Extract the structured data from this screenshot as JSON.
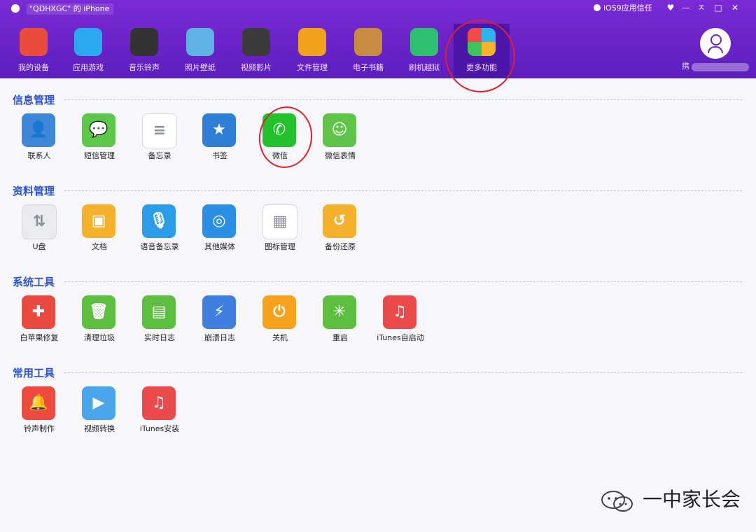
{
  "window": {
    "device_name": "\"QDHXGC\" 的 iPhone",
    "trust_label": "iOS9应用信任",
    "controls": [
      "♥",
      "—",
      "ㅈ",
      "□",
      "✕"
    ]
  },
  "nav": {
    "items": [
      {
        "label": "我的设备",
        "icon": "my-device-icon",
        "color": "#e94b3c"
      },
      {
        "label": "应用游戏",
        "icon": "app-store-icon",
        "color": "#2aa8f2"
      },
      {
        "label": "音乐铃声",
        "icon": "music-ringtone-icon",
        "color": "#333333"
      },
      {
        "label": "照片壁纸",
        "icon": "photo-wallpaper-icon",
        "color": "#5fb1e6"
      },
      {
        "label": "视频影片",
        "icon": "video-clapper-icon",
        "color": "#3b3b3b"
      },
      {
        "label": "文件管理",
        "icon": "file-folder-icon",
        "color": "#f0a21c"
      },
      {
        "label": "电子书籍",
        "icon": "ebook-icon",
        "color": "#c98a42"
      },
      {
        "label": "刷机越狱",
        "icon": "flash-jailbreak-icon",
        "color": "#2fbf71"
      },
      {
        "label": "更多功能",
        "icon": "more-features-icon",
        "color": "#ffffff",
        "active": true
      }
    ],
    "user_label": "携"
  },
  "sections": [
    {
      "title": "信息管理",
      "items": [
        {
          "label": "联系人",
          "icon": "contacts-icon",
          "color": "#3d86d8",
          "glyph": "👤"
        },
        {
          "label": "短信管理",
          "icon": "sms-icon",
          "color": "#5cc84a",
          "glyph": "💬"
        },
        {
          "label": "备忘录",
          "icon": "notes-icon",
          "color": "#ffffff",
          "glyph": "≡"
        },
        {
          "label": "书签",
          "icon": "bookmark-icon",
          "color": "#2f7fd6",
          "glyph": "★"
        },
        {
          "label": "微信",
          "icon": "wechat-icon",
          "color": "#23c12c",
          "glyph": "✆"
        },
        {
          "label": "微信表情",
          "icon": "wechat-emoji-icon",
          "color": "#5ec54a",
          "glyph": "☺"
        }
      ]
    },
    {
      "title": "资料管理",
      "items": [
        {
          "label": "U盘",
          "icon": "usb-drive-icon",
          "color": "#e9ebef",
          "glyph": "⇅"
        },
        {
          "label": "文档",
          "icon": "document-icon",
          "color": "#f6b12c",
          "glyph": "▣"
        },
        {
          "label": "语音备忘录",
          "icon": "voice-memo-icon",
          "color": "#2b9de8",
          "glyph": "🎙"
        },
        {
          "label": "其他媒体",
          "icon": "other-media-icon",
          "color": "#2c8fe6",
          "glyph": "◎"
        },
        {
          "label": "图标管理",
          "icon": "icon-manager-icon",
          "color": "#ffffff",
          "glyph": "▦"
        },
        {
          "label": "备份还原",
          "icon": "backup-restore-icon",
          "color": "#f6b12c",
          "glyph": "↺"
        }
      ]
    },
    {
      "title": "系统工具",
      "items": [
        {
          "label": "白苹果修复",
          "icon": "apple-repair-icon",
          "color": "#ea4a3f",
          "glyph": "✚"
        },
        {
          "label": "清理垃圾",
          "icon": "trash-clean-icon",
          "color": "#5cbf3f",
          "glyph": "🗑"
        },
        {
          "label": "实时日志",
          "icon": "realtime-log-icon",
          "color": "#5cbf3f",
          "glyph": "▤"
        },
        {
          "label": "崩溃日志",
          "icon": "crash-log-icon",
          "color": "#3f7fe0",
          "glyph": "⚡"
        },
        {
          "label": "关机",
          "icon": "power-off-icon",
          "color": "#f6a21c",
          "glyph": "⏻"
        },
        {
          "label": "重启",
          "icon": "restart-icon",
          "color": "#5cbf3f",
          "glyph": "✳"
        },
        {
          "label": "iTunes自启动",
          "icon": "itunes-autostart-icon",
          "color": "#ea4a4a",
          "glyph": "♫"
        }
      ]
    },
    {
      "title": "常用工具",
      "items": [
        {
          "label": "铃声制作",
          "icon": "ringtone-maker-icon",
          "color": "#ef4a3f",
          "glyph": "🔔"
        },
        {
          "label": "视频转换",
          "icon": "video-convert-icon",
          "color": "#4aa6ea",
          "glyph": "▶"
        },
        {
          "label": "iTunes安装",
          "icon": "itunes-install-icon",
          "color": "#ea4a4a",
          "glyph": "♫"
        }
      ]
    }
  ],
  "watermark": {
    "text": "一中家长会",
    "icon": "wechat-logo-icon"
  }
}
